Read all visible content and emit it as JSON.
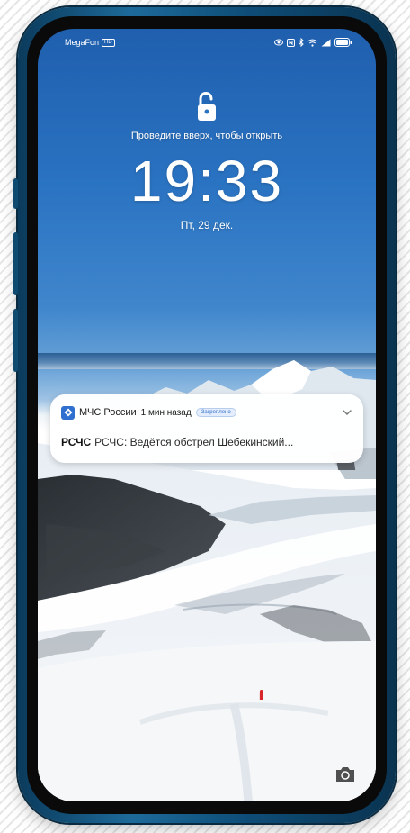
{
  "status_bar": {
    "carrier": "MegaFon",
    "network_badge": "HD",
    "icons": [
      "eye-icon",
      "nfc-icon",
      "bluetooth-icon",
      "wifi-icon",
      "signal-icon",
      "battery-icon"
    ]
  },
  "lock_screen": {
    "lock_icon": "unlock-icon",
    "swipe_hint": "Проведите вверх, чтобы открыть",
    "time": "19:33",
    "date": "Пт, 29 дек."
  },
  "notification": {
    "app_icon": "mchs-app-icon",
    "app_name": "МЧС России",
    "time_ago": "1 мин назад",
    "tag": "Закреплено",
    "sender": "РСЧС",
    "message": "РСЧС: Ведётся обстрел Шебекинский...",
    "expand_icon": "chevron-down-icon"
  },
  "shortcut": {
    "camera_icon": "camera-icon"
  },
  "colors": {
    "frame": "#1d6a9a",
    "sky": "#2a73c2",
    "accent": "#2f6fcf"
  }
}
